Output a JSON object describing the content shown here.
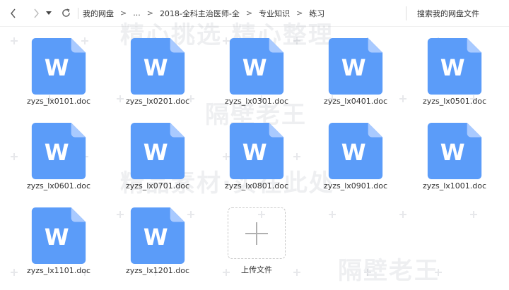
{
  "toolbar": {
    "breadcrumbs": [
      "我的网盘",
      "...",
      "2018-全科主治医师-全",
      "专业知识",
      "练习"
    ],
    "search_label": "搜索我的网盘文件"
  },
  "files": [
    {
      "name": "zyzs_lx0101.doc",
      "icon_letter": "W"
    },
    {
      "name": "zyzs_lx0201.doc",
      "icon_letter": "W"
    },
    {
      "name": "zyzs_lx0301.doc",
      "icon_letter": "W"
    },
    {
      "name": "zyzs_lx0401.doc",
      "icon_letter": "W"
    },
    {
      "name": "zyzs_lx0501.doc",
      "icon_letter": "W"
    },
    {
      "name": "zyzs_lx0601.doc",
      "icon_letter": "W"
    },
    {
      "name": "zyzs_lx0701.doc",
      "icon_letter": "W"
    },
    {
      "name": "zyzs_lx0801.doc",
      "icon_letter": "W"
    },
    {
      "name": "zyzs_lx0901.doc",
      "icon_letter": "W"
    },
    {
      "name": "zyzs_lx1001.doc",
      "icon_letter": "W"
    },
    {
      "name": "zyzs_lx1101.doc",
      "icon_letter": "W"
    },
    {
      "name": "zyzs_lx1201.doc",
      "icon_letter": "W"
    }
  ],
  "upload": {
    "label": "上传文件"
  },
  "watermark": {
    "lines": [
      "精心挑选 精心整理",
      "隔壁老王",
      "精品素材·实在此处",
      "隔壁老王"
    ]
  },
  "colors": {
    "doc_icon": "#5b9cf9",
    "doc_fold": "#a9caff",
    "upload_plus": "#b0b0b0"
  }
}
